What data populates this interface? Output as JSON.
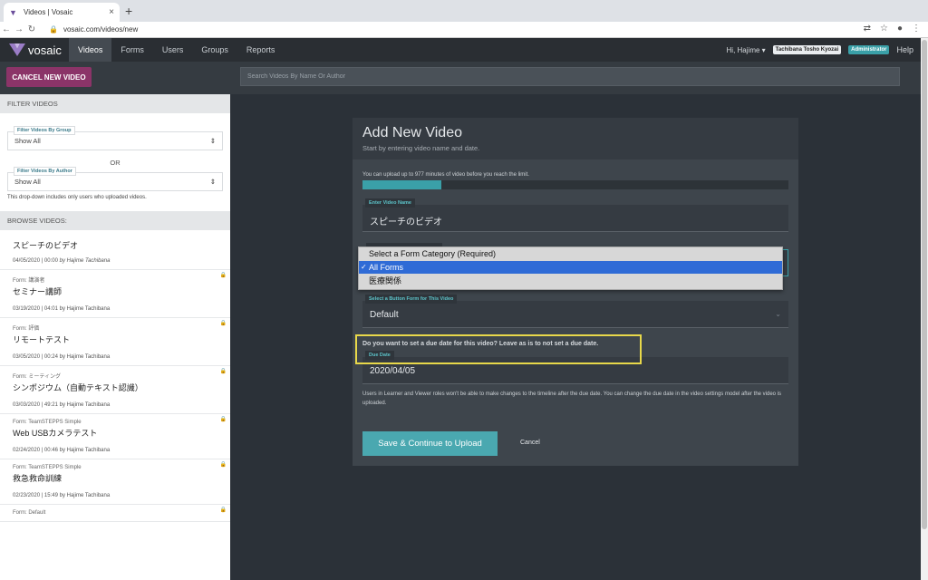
{
  "browser": {
    "tab_title": "Videos | Vosaic",
    "tab_close": "×",
    "new_tab": "+",
    "url": "vosaic.com/videos/new"
  },
  "nav": {
    "logo_text": "vosaic",
    "items": [
      "Videos",
      "Forms",
      "Users",
      "Groups",
      "Reports"
    ],
    "greeting": "Hi, Hajime ▾",
    "org": "Tachibana Tosho Kyozai",
    "role": "Administrator",
    "help": "Help"
  },
  "toolbar": {
    "cancel_label": "CANCEL NEW VIDEO",
    "search_placeholder": "Search Videos By Name Or Author"
  },
  "sidebar": {
    "filter_head": "FILTER VIDEOS",
    "group_label": "Filter Videos By Group",
    "group_value": "Show All",
    "or": "OR",
    "author_label": "Filter Videos By Author",
    "author_value": "Show All",
    "hint": "This drop-down includes only users who uploaded videos.",
    "browse_head": "BROWSE VIDEOS:",
    "videos": [
      {
        "form": "",
        "title": "スピーチのビデオ",
        "date": "04/05/2020 | 00:00",
        "author": "by Hajime Tachibana",
        "locked": false
      },
      {
        "form": "Form: 講演者",
        "title": "セミナー講師",
        "date": "03/19/2020 | 04:01",
        "author": "by Hajime Tachibana",
        "locked": true
      },
      {
        "form": "Form: 評価",
        "title": "リモートテスト",
        "date": "03/05/2020 | 00:24",
        "author": "by Hajime Tachibana",
        "locked": true
      },
      {
        "form": "Form: ミーティング",
        "title": "シンポジウム（自動テキスト認識）",
        "date": "03/03/2020 | 49:21",
        "author": "by Hajime Tachibana",
        "locked": true
      },
      {
        "form": "Form: TeamSTEPPS Simple",
        "title": "Web USBカメラテスト",
        "date": "02/24/2020 | 00:46",
        "author": "by Hajime Tachibana",
        "locked": true
      },
      {
        "form": "Form: TeamSTEPPS Simple",
        "title": "救急救命訓練",
        "date": "02/23/2020 | 15:49",
        "author": "by Hajime Tachibana",
        "locked": true
      },
      {
        "form": "Form: Default",
        "title": "",
        "date": "",
        "author": "",
        "locked": true
      }
    ]
  },
  "modal": {
    "title": "Add New Video",
    "subtitle": "Start by entering video name and date.",
    "limit_text": "You can upload up to 977 minutes of video before you reach the limit.",
    "progress_fraction": 0.185,
    "name_label": "Enter Video Name",
    "name_value": "スピーチのビデオ",
    "dropdown_options": [
      "Select a Form Category (Required)",
      "All Forms",
      "医療関係"
    ],
    "dropdown_selected": "All Forms",
    "check": "✓",
    "button_form_label": "Select a Button Form for This Video",
    "button_form_value": "Default",
    "due_question": "Do you want to set a due date for this video? Leave as is to not set a due date.",
    "due_label": "Due Date",
    "due_value": "2020/04/05",
    "note": "Users in Learner and Viewer roles won't be able to make changes to the timeline after the due date. You can change the due date in the video settings model after the video is uploaded.",
    "save_label": "Save & Continue to Upload",
    "cancel_label": "Cancel"
  },
  "colors": {
    "accent": "#3aa0a8",
    "cancel": "#8b3468",
    "highlight": "#e8d84a",
    "selected_option": "#2f6bd6"
  }
}
